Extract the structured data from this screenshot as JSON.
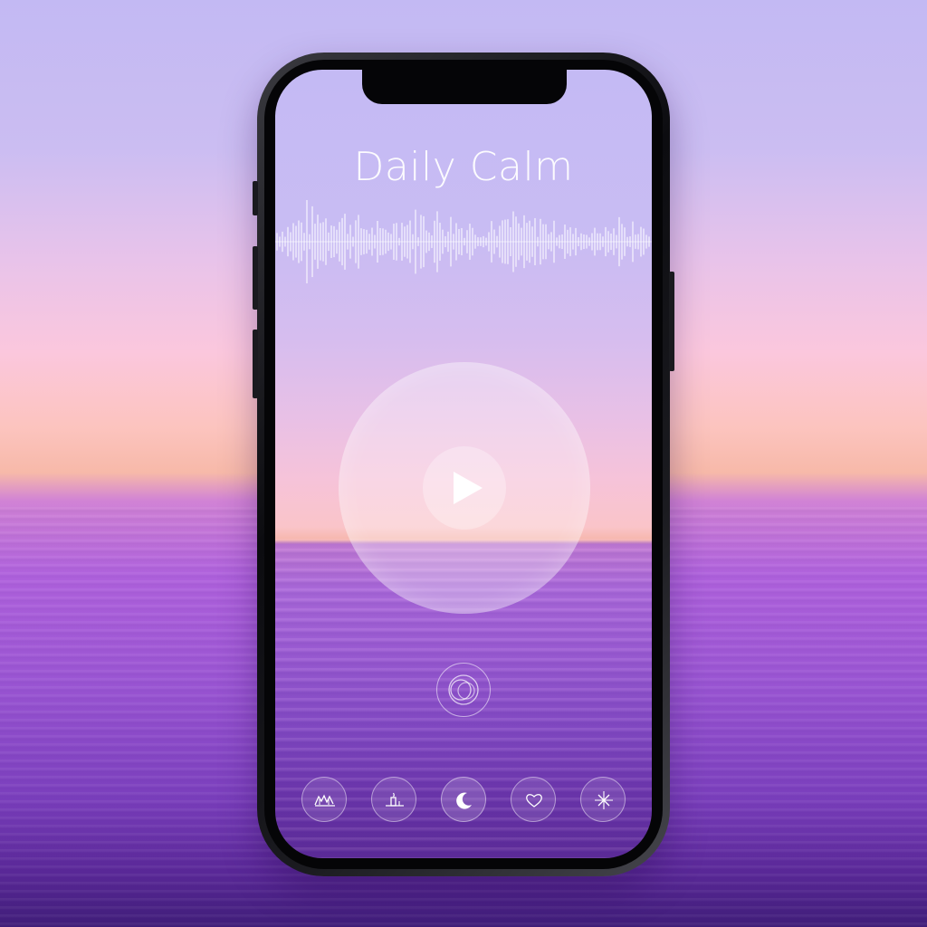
{
  "app": {
    "title": "Daily Calm"
  },
  "player": {
    "state": "paused",
    "play_icon": "play-icon"
  },
  "mode_button": {
    "icon": "breathe-rings-icon"
  },
  "bottom_nav": {
    "items": [
      {
        "id": "nature",
        "icon": "landscape-icon",
        "active": false
      },
      {
        "id": "focus",
        "icon": "candle-icon",
        "active": false
      },
      {
        "id": "sleep",
        "icon": "moon-icon",
        "active": true
      },
      {
        "id": "mood",
        "icon": "heart-icon",
        "active": false
      },
      {
        "id": "energy",
        "icon": "sparkle-icon",
        "active": false
      }
    ]
  },
  "colors": {
    "sky_top": "#c4baf4",
    "horizon": "#f6b7ad",
    "sea": "#9a5bd2",
    "text": "#ffffff"
  }
}
